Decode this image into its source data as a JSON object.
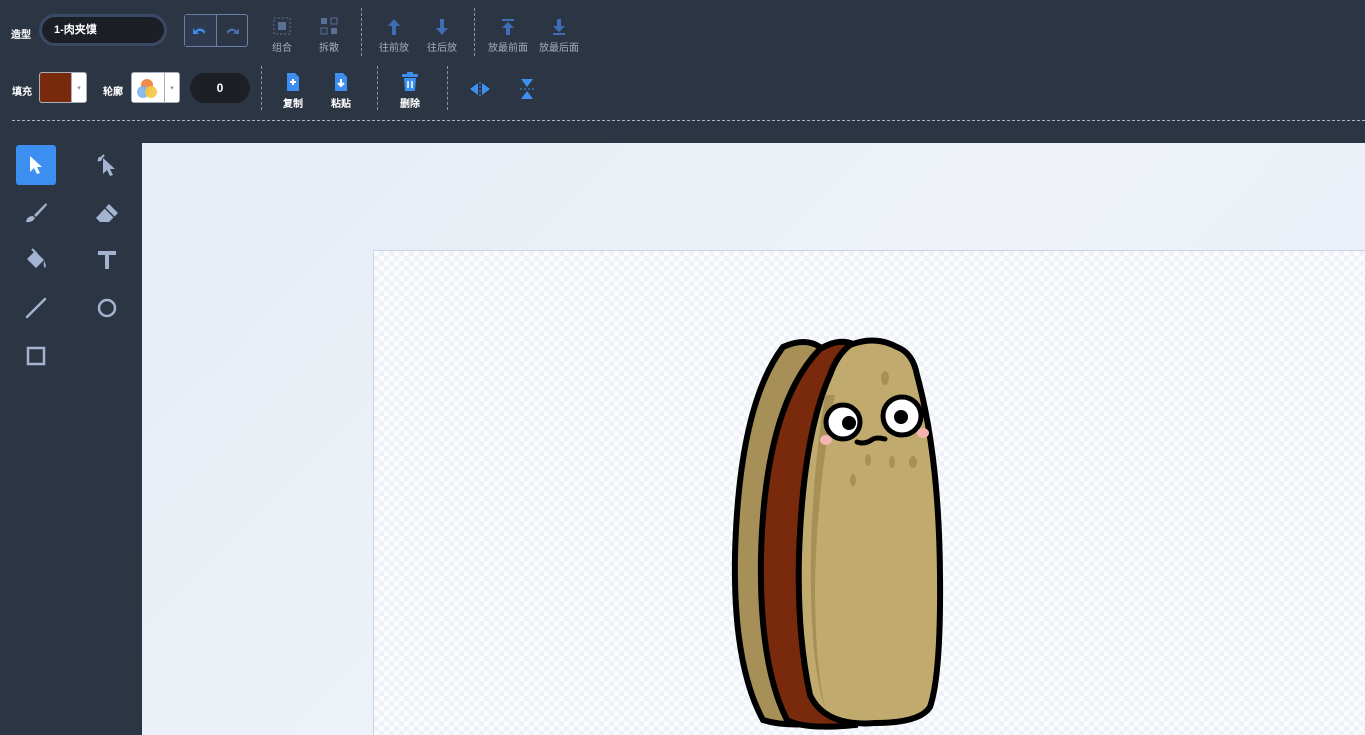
{
  "toolbar": {
    "costume_label": "造型",
    "costume_name": "1-肉夹馍",
    "group_label": "组合",
    "ungroup_label": "拆散",
    "forward_label": "往前放",
    "backward_label": "往后放",
    "front_label": "放最前面",
    "back_label": "放最后面",
    "fill_label": "填充",
    "fill_color": "#7a2a0c",
    "outline_label": "轮廓",
    "outline_width": "0",
    "copy_label": "复制",
    "paste_label": "粘贴",
    "delete_label": "删除"
  },
  "tools": [
    "select-tool",
    "reshape-tool",
    "brush-tool",
    "eraser-tool",
    "fill-tool",
    "text-tool",
    "line-tool",
    "circle-tool",
    "rect-tool"
  ],
  "colors": {
    "bg": "#2c3543",
    "accent": "#3c8ff0",
    "bread": "#c1aa6e",
    "bread_dark": "#a78f58",
    "meat": "#7a2a0c"
  }
}
